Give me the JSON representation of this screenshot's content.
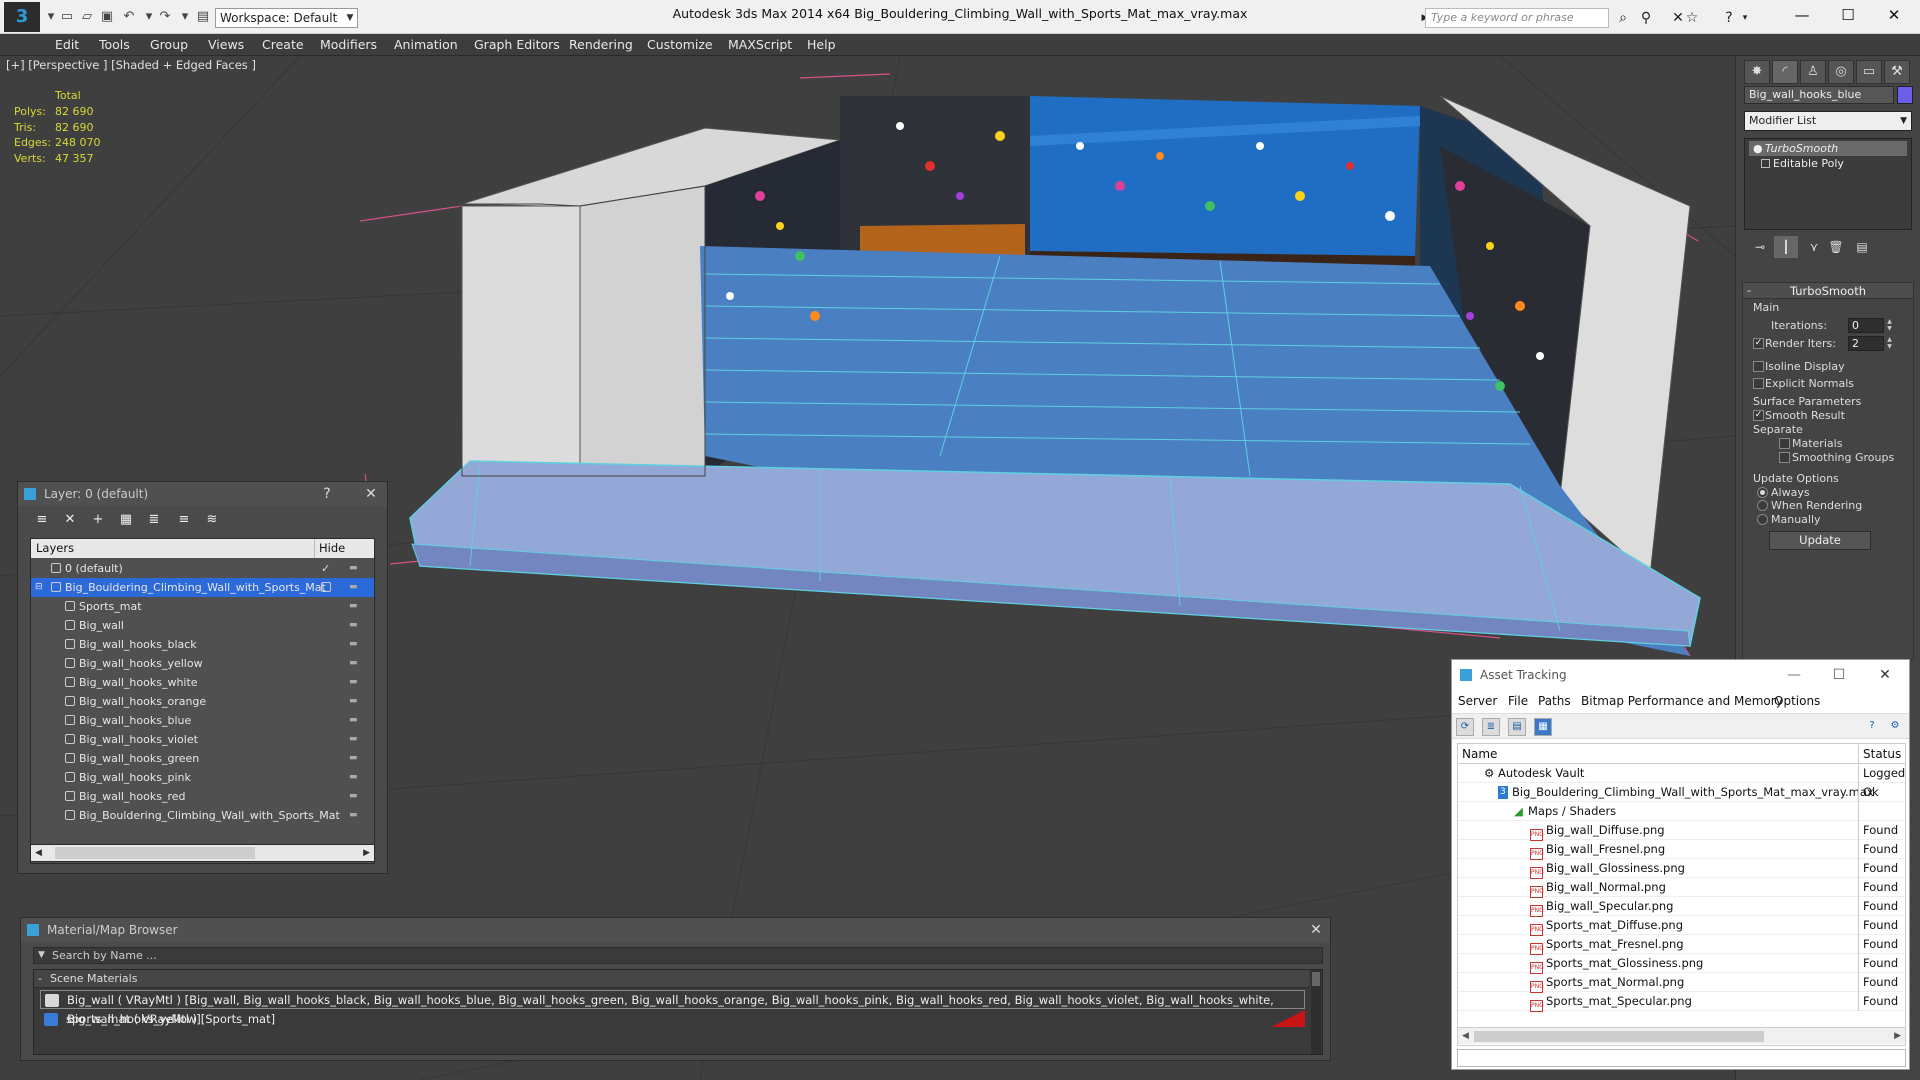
{
  "titlebar": {
    "app_title": "Autodesk 3ds Max  2014 x64      Big_Bouldering_Climbing_Wall_with_Sports_Mat_max_vray.max",
    "workspace": "Workspace: Default",
    "search_placeholder": "Type a keyword or phrase"
  },
  "menu": [
    "Edit",
    "Tools",
    "Group",
    "Views",
    "Create",
    "Modifiers",
    "Animation",
    "Graph Editors",
    "Rendering",
    "Customize",
    "MAXScript",
    "Help"
  ],
  "viewport": {
    "label": "[+] [Perspective ] [Shaded + Edged Faces ]",
    "stats": {
      "header": "Total",
      "polys_label": "Polys:",
      "polys": "82 690",
      "tris_label": "Tris:",
      "tris": "82 690",
      "edges_label": "Edges:",
      "edges": "248 070",
      "verts_label": "Verts:",
      "verts": "47 357"
    }
  },
  "command_panel": {
    "object_name": "Big_wall_hooks_blue",
    "object_color": "#6b5ee8",
    "modifier_list": "Modifier List",
    "stack": [
      "TurboSmooth",
      "Editable Poly"
    ],
    "rollout_title": "TurboSmooth",
    "main_label": "Main",
    "iterations_label": "Iterations:",
    "iterations": "0",
    "render_iters_label": "Render Iters:",
    "render_iters": "2",
    "isoline_display": "Isoline Display",
    "explicit_normals": "Explicit Normals",
    "surface_parameters": "Surface Parameters",
    "smooth_result": "Smooth Result",
    "separate": "Separate",
    "materials": "Materials",
    "smoothing_groups": "Smoothing Groups",
    "update_options": "Update Options",
    "always": "Always",
    "when_rendering": "When Rendering",
    "manually": "Manually",
    "update_button": "Update"
  },
  "layer_window": {
    "title": "Layer: 0 (default)",
    "help": "?",
    "close": "✕",
    "col_layers": "Layers",
    "col_hide": "Hide",
    "rows": [
      "0 (default)",
      "Big_Bouldering_Climbing_Wall_with_Sports_Mat",
      "Sports_mat",
      "Big_wall",
      "Big_wall_hooks_black",
      "Big_wall_hooks_yellow",
      "Big_wall_hooks_white",
      "Big_wall_hooks_orange",
      "Big_wall_hooks_blue",
      "Big_wall_hooks_violet",
      "Big_wall_hooks_green",
      "Big_wall_hooks_pink",
      "Big_wall_hooks_red",
      "Big_Bouldering_Climbing_Wall_with_Sports_Mat"
    ]
  },
  "material_browser": {
    "title": "Material/Map Browser",
    "search": "Search by Name ...",
    "section": "Scene Materials",
    "items": [
      "Big_wall  ( VRayMtl ) [Big_wall, Big_wall_hooks_black, Big_wall_hooks_blue, Big_wall_hooks_green, Big_wall_hooks_orange, Big_wall_hooks_pink, Big_wall_hooks_red, Big_wall_hooks_violet, Big_wall_hooks_white, Big_wall_hooks_yellow]",
      "sports_mat  ( VRayMtl ) [Sports_mat]"
    ]
  },
  "asset_tracking": {
    "title": "Asset Tracking",
    "menu": [
      "Server",
      "File",
      "Paths",
      "Bitmap Performance and Memory",
      "Options"
    ],
    "col_name": "Name",
    "col_status": "Status",
    "rows": [
      {
        "name": "Autodesk Vault",
        "status": "Logged"
      },
      {
        "name": "Big_Bouldering_Climbing_Wall_with_Sports_Mat_max_vray.max",
        "status": "Ok"
      },
      {
        "name": "Maps / Shaders",
        "status": ""
      },
      {
        "name": "Big_wall_Diffuse.png",
        "status": "Found"
      },
      {
        "name": "Big_wall_Fresnel.png",
        "status": "Found"
      },
      {
        "name": "Big_wall_Glossiness.png",
        "status": "Found"
      },
      {
        "name": "Big_wall_Normal.png",
        "status": "Found"
      },
      {
        "name": "Big_wall_Specular.png",
        "status": "Found"
      },
      {
        "name": "Sports_mat_Diffuse.png",
        "status": "Found"
      },
      {
        "name": "Sports_mat_Fresnel.png",
        "status": "Found"
      },
      {
        "name": "Sports_mat_Glossiness.png",
        "status": "Found"
      },
      {
        "name": "Sports_mat_Normal.png",
        "status": "Found"
      },
      {
        "name": "Sports_mat_Specular.png",
        "status": "Found"
      }
    ]
  }
}
